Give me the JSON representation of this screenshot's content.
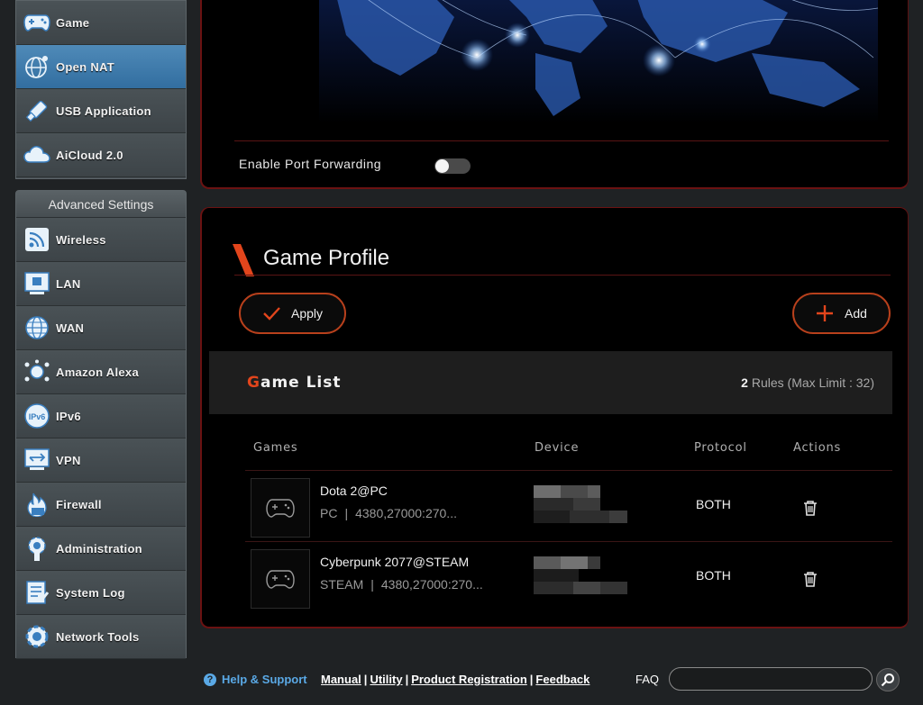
{
  "sidebar": {
    "top_items": [
      {
        "label": "Game",
        "icon": "gamepad-icon",
        "active": false
      },
      {
        "label": "Open NAT",
        "icon": "globe-network-icon",
        "active": true
      },
      {
        "label": "USB Application",
        "icon": "usb-stick-icon",
        "active": false
      },
      {
        "label": "AiCloud 2.0",
        "icon": "cloud-icon",
        "active": false
      }
    ],
    "advanced_header": "Advanced Settings",
    "advanced_items": [
      {
        "label": "Wireless",
        "icon": "wifi-icon"
      },
      {
        "label": "LAN",
        "icon": "lan-icon"
      },
      {
        "label": "WAN",
        "icon": "globe-icon"
      },
      {
        "label": "Amazon Alexa",
        "icon": "alexa-icon"
      },
      {
        "label": "IPv6",
        "icon": "ipv6-icon"
      },
      {
        "label": "VPN",
        "icon": "vpn-icon"
      },
      {
        "label": "Firewall",
        "icon": "firewall-icon"
      },
      {
        "label": "Administration",
        "icon": "admin-gear-icon"
      },
      {
        "label": "System Log",
        "icon": "system-log-icon"
      },
      {
        "label": "Network Tools",
        "icon": "network-tools-icon"
      }
    ]
  },
  "port_forwarding": {
    "label": "Enable Port Forwarding",
    "enabled": false
  },
  "game_profile": {
    "title": "Game Profile",
    "apply_label": "Apply",
    "add_label": "Add"
  },
  "game_list": {
    "title_first": "G",
    "title_rest": "ame List",
    "rules_count": "2",
    "rules_text": "Rules (Max Limit : 32)",
    "columns": {
      "games": "Games",
      "device": "Device",
      "protocol": "Protocol",
      "actions": "Actions"
    },
    "rows": [
      {
        "name": "Dota 2@PC",
        "platform": "PC",
        "ports": "4380,27000:270...",
        "protocol": "BOTH"
      },
      {
        "name": "Cyberpunk 2077@STEAM",
        "platform": "STEAM",
        "ports": "4380,27000:270...",
        "protocol": "BOTH"
      }
    ]
  },
  "footer": {
    "help_label": "Help & Support",
    "links": [
      "Manual",
      "Utility",
      "Product Registration",
      "Feedback"
    ],
    "faq_label": "FAQ",
    "faq_value": ""
  },
  "colors": {
    "accent": "#e2451c",
    "active_menu": "#3f7fb2",
    "link_blue": "#5aa9e6"
  }
}
